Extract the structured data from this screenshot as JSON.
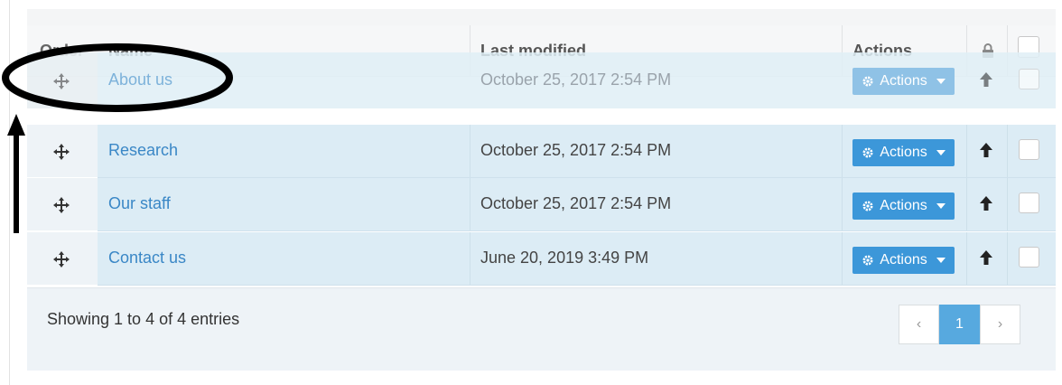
{
  "table": {
    "headers": {
      "order": "Order",
      "name": "Name",
      "last_modified": "Last modified",
      "actions": "Actions"
    },
    "dragged_row": {
      "name": "About us",
      "date": "October 25, 2017 2:54 PM",
      "actions_label": "Actions"
    },
    "rows": [
      {
        "name": "Research",
        "date": "October 25, 2017 2:54 PM",
        "actions_label": "Actions"
      },
      {
        "name": "Our staff",
        "date": "October 25, 2017 2:54 PM",
        "actions_label": "Actions"
      },
      {
        "name": "Contact us",
        "date": "June 20, 2019 3:49 PM",
        "actions_label": "Actions"
      }
    ]
  },
  "footer": {
    "showing": "Showing 1 to 4 of 4 entries",
    "pagination": {
      "prev": "‹",
      "current": "1",
      "next": "›"
    }
  },
  "icons": {
    "move": "move-icon",
    "lock": "lock-icon",
    "up_arrow": "arrow-up-icon",
    "gear": "gear-icon",
    "caret": "caret-down-icon"
  },
  "colors": {
    "accent": "#3c97d9",
    "link": "#3a87c6",
    "row_bg": "#dcecf5"
  }
}
